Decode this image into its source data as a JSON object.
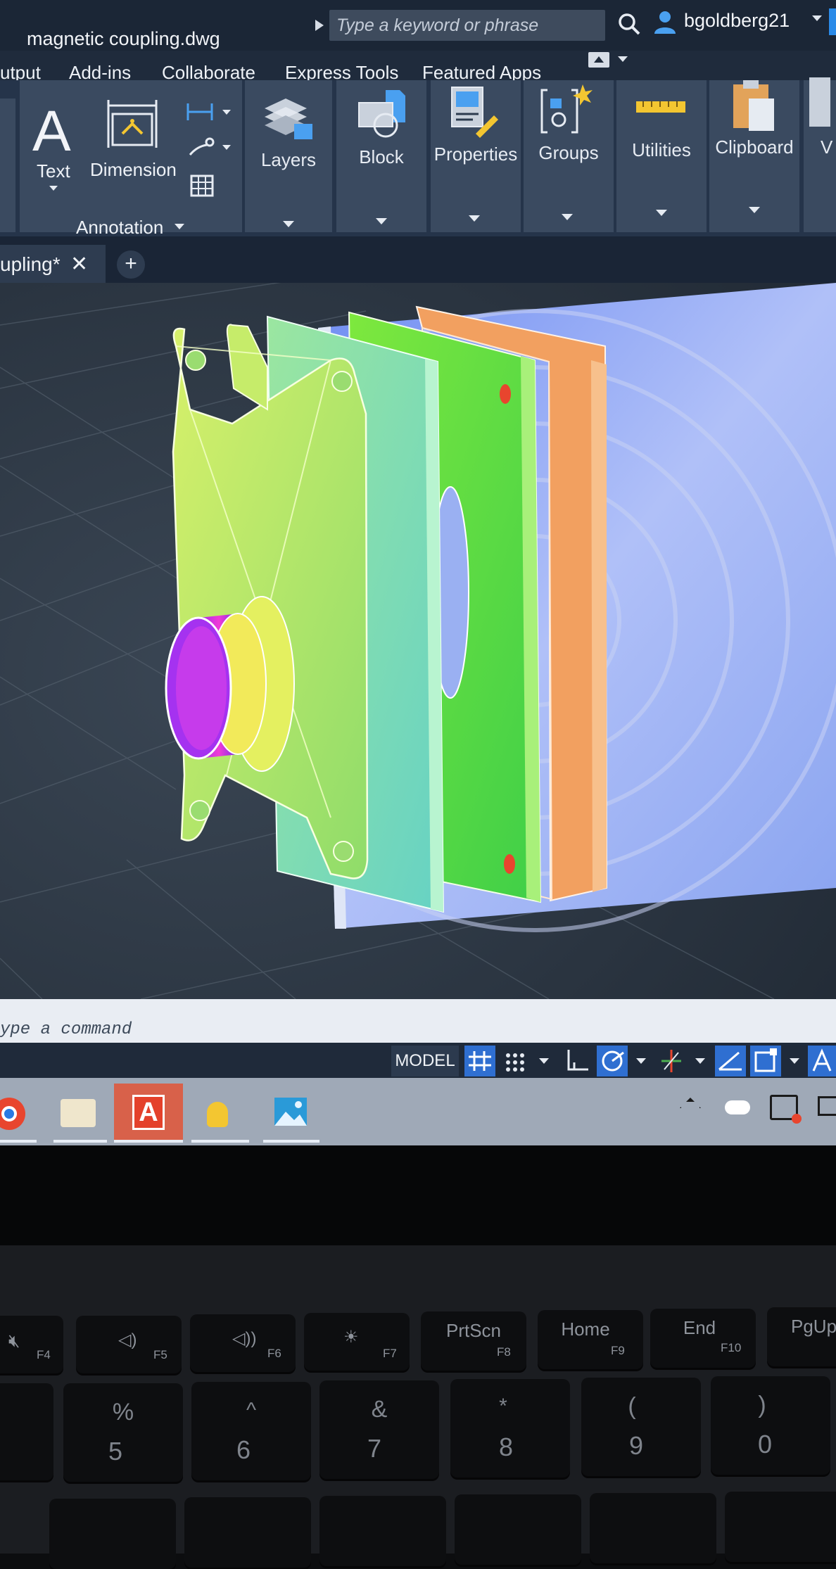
{
  "window": {
    "file_title": "magnetic coupling.dwg",
    "search_placeholder": "Type a keyword or phrase",
    "user_name": "bgoldberg21"
  },
  "menu": {
    "items": [
      "utput",
      "Add-ins",
      "Collaborate",
      "Express Tools",
      "Featured Apps"
    ]
  },
  "ribbon": {
    "text_label": "Text",
    "dimension_label": "Dimension",
    "annotation_label": "Annotation",
    "panels": [
      "Layers",
      "Block",
      "Properties",
      "Groups",
      "Utilities",
      "Clipboard",
      "V"
    ]
  },
  "tabs": {
    "active_label": "upling*",
    "close_glyph": "✕",
    "add_glyph": "+"
  },
  "command": {
    "placeholder": "ype a command"
  },
  "status": {
    "model_label": "MODEL"
  },
  "taskbar": {
    "autocad_letter": "A"
  },
  "keyboard": {
    "fn_row": [
      {
        "main": "",
        "fn": "F4"
      },
      {
        "main": "",
        "fn": "F5"
      },
      {
        "main": "",
        "fn": "F6"
      },
      {
        "main": "",
        "fn": "F7"
      },
      {
        "main": "PrtScn",
        "fn": "F8"
      },
      {
        "main": "Home",
        "fn": "F9"
      },
      {
        "main": "End",
        "fn": "F10"
      },
      {
        "main": "PgUp",
        "fn": ""
      }
    ],
    "num_row": [
      {
        "top": "%",
        "bottom": "5"
      },
      {
        "top": "^",
        "bottom": "6"
      },
      {
        "top": "&",
        "bottom": "7"
      },
      {
        "top": "*",
        "bottom": "8"
      },
      {
        "top": "(",
        "bottom": "9"
      },
      {
        "top": ")",
        "bottom": "0"
      }
    ]
  },
  "colors": {
    "titlebar": "#1b2636",
    "ribbon_panel": "#3a4a60",
    "accent_blue": "#2f6fd1",
    "autocad_red": "#e4412b"
  }
}
